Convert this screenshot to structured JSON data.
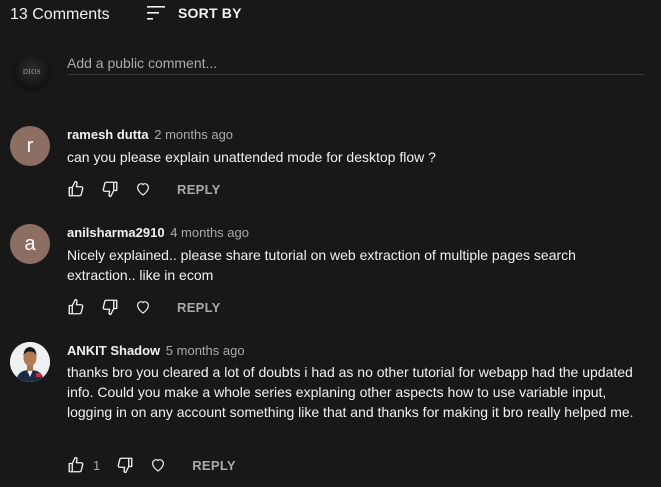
{
  "header": {
    "comment_count": "13 Comments",
    "sort_label": "SORT BY"
  },
  "add_comment": {
    "placeholder": "Add a public comment...",
    "avatar_text": "DIOS"
  },
  "comments": [
    {
      "avatar_letter": "r",
      "avatar_color": "#8d6e63",
      "author": "ramesh dutta",
      "time": "2 months ago",
      "text": "can you please explain unattended mode for desktop flow ?",
      "likes": "",
      "reply_label": "REPLY"
    },
    {
      "avatar_letter": "a",
      "avatar_color": "#8d6e63",
      "author": "anilsharma2910",
      "time": "4 months ago",
      "text": "Nicely explained.. please share tutorial on web extraction of multiple pages search extraction.. like in ecom",
      "likes": "",
      "reply_label": "REPLY"
    },
    {
      "avatar_letter": "",
      "avatar_color": "#f4f4f4",
      "author": "ANKIT Shadow",
      "time": "5 months ago",
      "text": "thanks bro you cleared a lot of doubts i had as no other tutorial for webapp  had the updated info. Could you make a whole series explaning other aspects how to use variable input, logging in on any account something like that and thanks for making it bro really helped me.",
      "likes": "1",
      "reply_label": "REPLY"
    }
  ],
  "icons": {
    "sort": "sort-icon",
    "like": "thumbs-up-icon",
    "dislike": "thumbs-down-icon",
    "heart": "heart-icon"
  },
  "colors": {
    "background": "#181818",
    "text": "#f1f1f1",
    "secondary_text": "#aaaaaa"
  }
}
